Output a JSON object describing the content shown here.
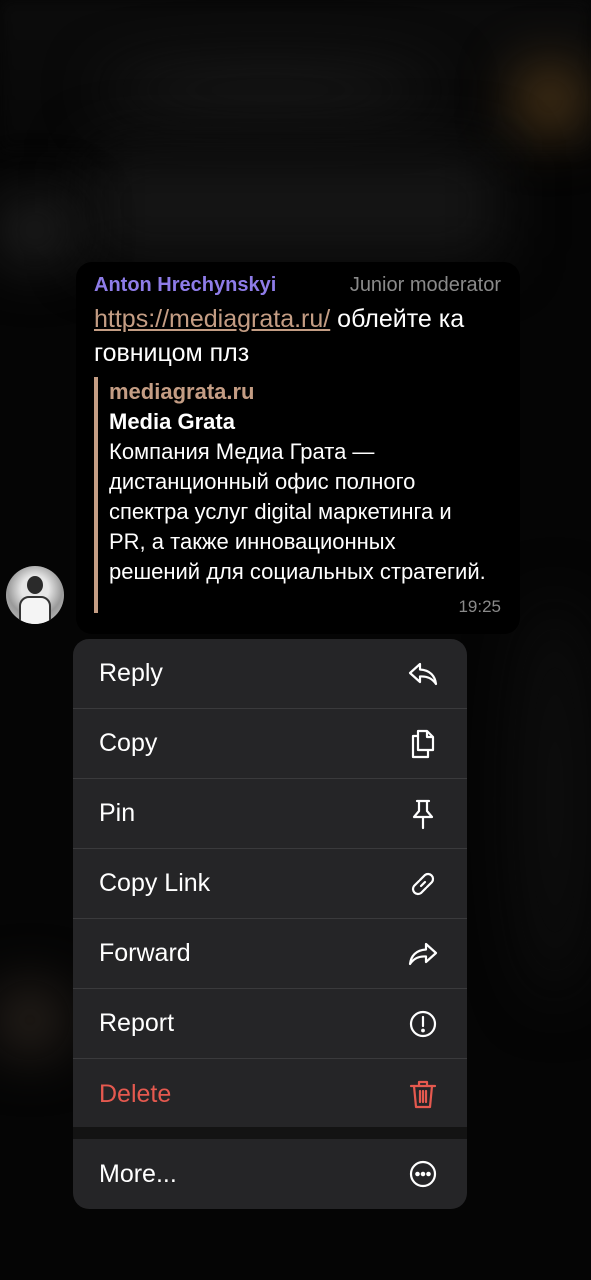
{
  "message": {
    "author": "Anton Hrechynskyi",
    "role": "Junior moderator",
    "link": "https://mediagrata.ru/",
    "text_after_link": " облейте ка говницом плз",
    "preview": {
      "site": "mediagrata.ru",
      "title": "Media Grata",
      "description": "Компания Медиа Грата — дистанционный офис полного спектра услуг digital маркетинга и PR, а также инновационных решений для социальных стратегий."
    },
    "time": "19:25"
  },
  "menu": {
    "items": [
      {
        "label": "Reply",
        "icon": "reply-icon"
      },
      {
        "label": "Copy",
        "icon": "copy-icon"
      },
      {
        "label": "Pin",
        "icon": "pin-icon"
      },
      {
        "label": "Copy Link",
        "icon": "link-icon"
      },
      {
        "label": "Forward",
        "icon": "forward-icon"
      },
      {
        "label": "Report",
        "icon": "report-icon"
      },
      {
        "label": "Delete",
        "icon": "trash-icon"
      },
      {
        "label": "More...",
        "icon": "more-icon"
      }
    ]
  },
  "colors": {
    "author": "#8e7ce8",
    "link": "#c49d84",
    "danger": "#e5594f",
    "menu_bg": "#252527"
  }
}
